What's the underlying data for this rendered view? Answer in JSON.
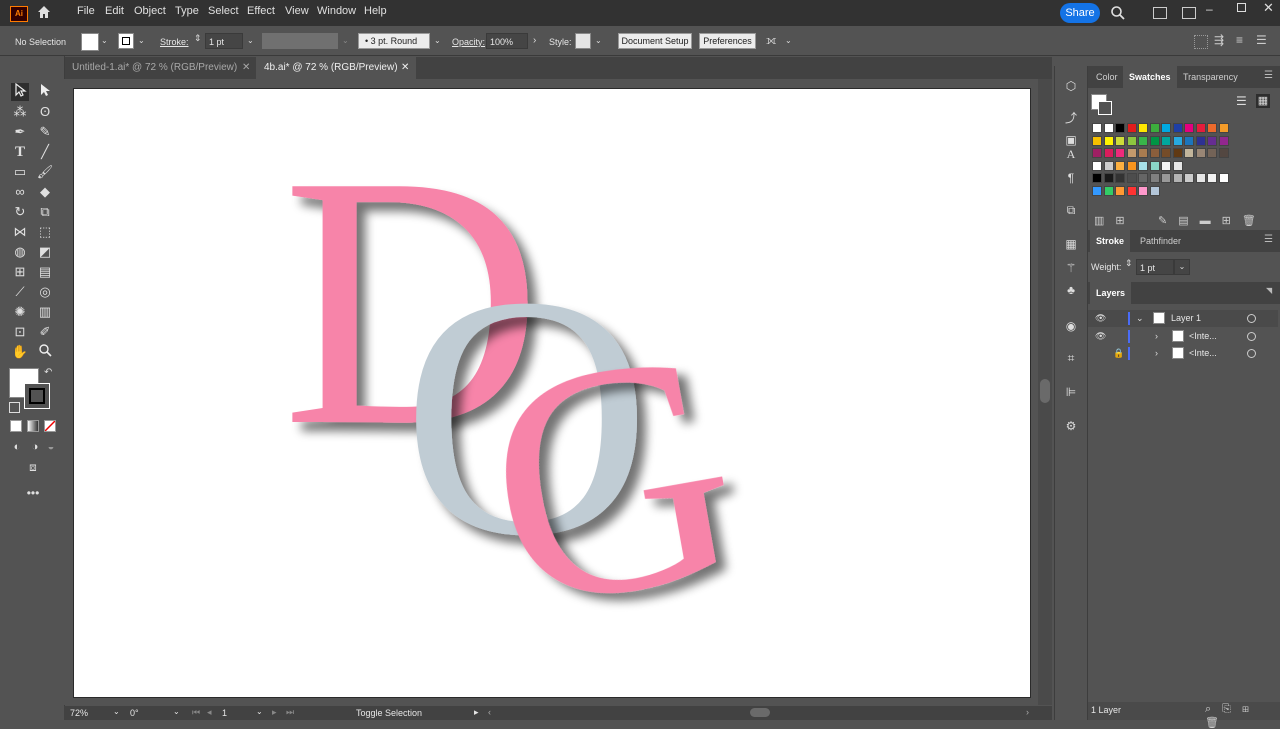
{
  "app": {
    "logo": "Ai"
  },
  "menu": [
    "File",
    "Edit",
    "Object",
    "Type",
    "Select",
    "Effect",
    "View",
    "Window",
    "Help"
  ],
  "share_label": "Share",
  "control": {
    "selection": "No Selection",
    "stroke_label": "Stroke:",
    "stroke_value": "1 pt",
    "brush_value": "3 pt. Round",
    "opacity_label": "Opacity:",
    "opacity_value": "100%",
    "style_label": "Style:",
    "document_setup": "Document Setup",
    "preferences": "Preferences"
  },
  "tabs": [
    {
      "label": "Untitled-1.ai* @ 72 % (RGB/Preview)",
      "active": false
    },
    {
      "label": "4b.ai* @ 72 % (RGB/Preview)",
      "active": true
    }
  ],
  "artwork": {
    "letters": [
      "D",
      "O",
      "G"
    ],
    "pink": "#f784a9",
    "gray": "#c0ccd4"
  },
  "status": {
    "zoom": "72%",
    "rotation": "0°",
    "artboard": "1",
    "mode": "Toggle Selection"
  },
  "panels": {
    "color_tabs": [
      "Color",
      "Swatches",
      "Transparency"
    ],
    "stroke_tabs": [
      "Stroke",
      "Pathfinder"
    ],
    "weight_label": "Weight:",
    "weight_value": "1 pt",
    "layers_tab": "Layers",
    "layers": [
      {
        "name": "Layer 1"
      },
      {
        "name": "<Inte..."
      },
      {
        "name": "<Inte..."
      }
    ],
    "layer_count": "1 Layer"
  },
  "swatch_rows": [
    [
      "#ffffff",
      "#ffffff",
      "#000000",
      "#e21c1c",
      "#ffe600",
      "#3dae3d",
      "#00a9e0",
      "#1f3fa6",
      "#e4007f",
      "#e51d3c",
      "#ec6a2c",
      "#f39b29"
    ],
    [
      "#f6c000",
      "#fff200",
      "#cddc39",
      "#8dc63f",
      "#39b54a",
      "#009444",
      "#00a79d",
      "#27aae1",
      "#1c75bc",
      "#2e3192",
      "#662d91",
      "#92278f"
    ],
    [
      "#9e1f63",
      "#da1c5c",
      "#ee2a7b",
      "#c49a6c",
      "#a97c50",
      "#8b5e3c",
      "#754c29",
      "#603913",
      "#c2b59b",
      "#998675",
      "#736357",
      "#534741"
    ],
    [
      "#ffffff",
      "#cccccc",
      "#fcb040",
      "#f7941d",
      "#a7e0e8",
      "#8ad5c7",
      "#f5f5f5",
      "#e6e6e6"
    ],
    [
      "#000000",
      "#1a1a1a",
      "#333333",
      "#4d4d4d",
      "#666666",
      "#808080",
      "#999999",
      "#b3b3b3",
      "#cccccc",
      "#e6e6e6",
      "#f2f2f2",
      "#ffffff"
    ],
    [
      "#3399ff",
      "#33cc66",
      "#ff9933",
      "#ff3333",
      "#ff99cc",
      "#b3c6d9"
    ]
  ]
}
